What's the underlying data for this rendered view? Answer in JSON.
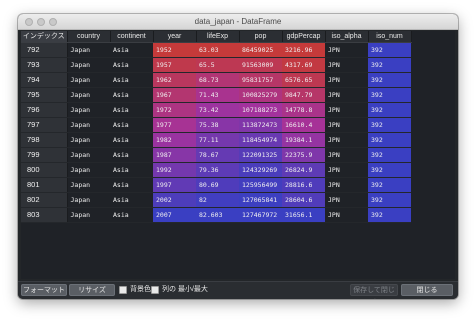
{
  "window": {
    "title": "data_japan - DataFrame"
  },
  "table": {
    "index_header": "インデックス",
    "columns": [
      "country",
      "continent",
      "year",
      "lifeExp",
      "pop",
      "gdpPercap",
      "iso_alpha",
      "iso_num"
    ],
    "rows": [
      {
        "index": "792",
        "cells": [
          "Japan",
          "Asia",
          "1952",
          "63.03",
          "86459025",
          "3216.96",
          "JPN",
          "392"
        ]
      },
      {
        "index": "793",
        "cells": [
          "Japan",
          "Asia",
          "1957",
          "65.5",
          "91563009",
          "4317.69",
          "JPN",
          "392"
        ]
      },
      {
        "index": "794",
        "cells": [
          "Japan",
          "Asia",
          "1962",
          "68.73",
          "95831757",
          "6576.65",
          "JPN",
          "392"
        ]
      },
      {
        "index": "795",
        "cells": [
          "Japan",
          "Asia",
          "1967",
          "71.43",
          "100825279",
          "9847.79",
          "JPN",
          "392"
        ]
      },
      {
        "index": "796",
        "cells": [
          "Japan",
          "Asia",
          "1972",
          "73.42",
          "107188273",
          "14778.8",
          "JPN",
          "392"
        ]
      },
      {
        "index": "797",
        "cells": [
          "Japan",
          "Asia",
          "1977",
          "75.38",
          "113872473",
          "16610.4",
          "JPN",
          "392"
        ]
      },
      {
        "index": "798",
        "cells": [
          "Japan",
          "Asia",
          "1982",
          "77.11",
          "118454974",
          "19384.1",
          "JPN",
          "392"
        ]
      },
      {
        "index": "799",
        "cells": [
          "Japan",
          "Asia",
          "1987",
          "78.67",
          "122091325",
          "22375.9",
          "JPN",
          "392"
        ]
      },
      {
        "index": "800",
        "cells": [
          "Japan",
          "Asia",
          "1992",
          "79.36",
          "124329269",
          "26824.9",
          "JPN",
          "392"
        ]
      },
      {
        "index": "801",
        "cells": [
          "Japan",
          "Asia",
          "1997",
          "80.69",
          "125956499",
          "28816.6",
          "JPN",
          "392"
        ]
      },
      {
        "index": "802",
        "cells": [
          "Japan",
          "Asia",
          "2002",
          "82",
          "127065841",
          "28604.6",
          "JPN",
          "392"
        ]
      },
      {
        "index": "803",
        "cells": [
          "Japan",
          "Asia",
          "2007",
          "82.603",
          "127467972",
          "31656.1",
          "JPN",
          "392"
        ]
      }
    ],
    "colors": {
      "high": "#c53a3a",
      "mid": "#a4329d",
      "low": "#3a3fc2"
    }
  },
  "footer": {
    "format_button": "フォーマット",
    "resize_button": "リサイズ",
    "background_label": "背景色",
    "minmax_label": "列の 最小/最大",
    "save_close_button": "保存して閉じる",
    "close_button": "閉じる"
  }
}
